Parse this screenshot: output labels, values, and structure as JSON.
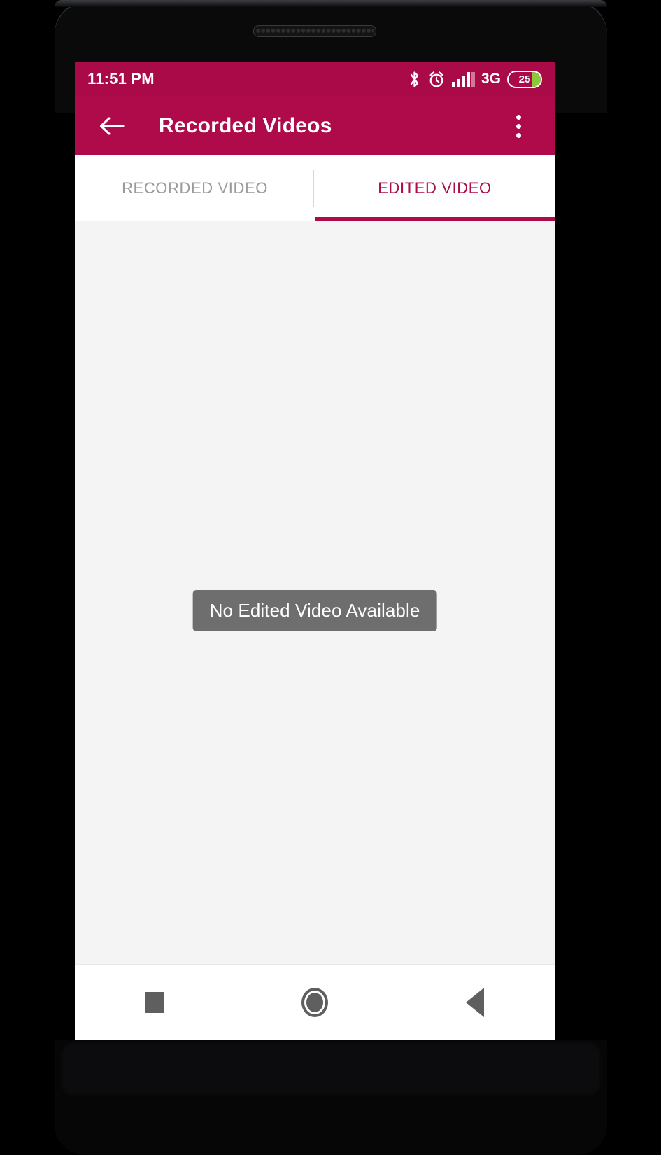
{
  "device": {
    "speaker_grille": "speaker-grille"
  },
  "status_bar": {
    "time": "11:51 PM",
    "network_type": "3G",
    "battery_percent": "25",
    "icons": [
      "bluetooth-icon",
      "alarm-icon",
      "signal-bars-icon",
      "battery-icon"
    ],
    "background_color": "#aa0a47"
  },
  "app_bar": {
    "title": "Recorded Videos",
    "back_icon": "back-arrow-icon",
    "overflow_icon": "overflow-menu-icon",
    "background_color": "#af0b4b"
  },
  "tabs": {
    "items": [
      {
        "label": "RECORDED VIDEO",
        "active": false
      },
      {
        "label": "EDITED VIDEO",
        "active": true
      }
    ],
    "active_color": "#ad0b49",
    "inactive_color": "#9a9a9a"
  },
  "content": {
    "toast_message": "No Edited Video Available",
    "toast_background": "#6e6e6e",
    "background_color": "#f4f4f4"
  },
  "nav_bar": {
    "buttons": [
      {
        "name": "recents-button",
        "icon": "square-icon"
      },
      {
        "name": "home-button",
        "icon": "circle-icon"
      },
      {
        "name": "back-button",
        "icon": "triangle-left-icon"
      }
    ],
    "icon_color": "#5f5f5f"
  }
}
